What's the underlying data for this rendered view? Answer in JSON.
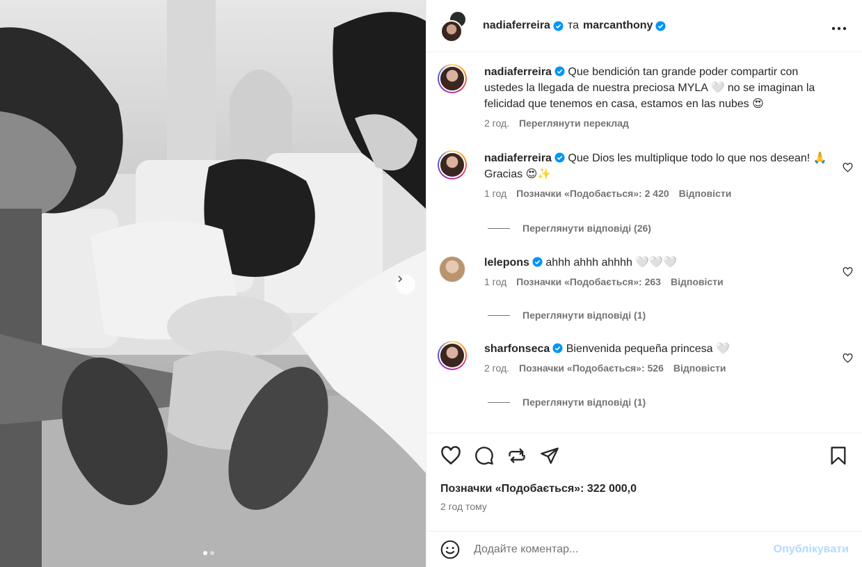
{
  "post": {
    "author": "nadiaferreira",
    "conjunction": "та",
    "coauthor": "marcanthony",
    "more_icon": "more-horizontal-icon"
  },
  "caption": {
    "user": "nadiaferreira",
    "text": "Que bendición tan grande poder compartir con ustedes la llegada de nuestra preciosa MYLA 🤍 no se imaginan la felicidad que tenemos en casa, estamos en las nubes 😍",
    "time": "2 год.",
    "translate": "Переглянути переклад"
  },
  "comments": [
    {
      "user": "nadiaferreira",
      "text": "Que Dios les multiplique todo lo que nos desean! 🙏 Gracias 😍✨",
      "time": "1 год",
      "likes": "Позначки «Подобається»: 2 420",
      "reply": "Відповісти",
      "view_replies": "Переглянути відповіді (26)"
    },
    {
      "user": "lelepons",
      "text": "ahhh ahhh ahhhh 🤍🤍🤍",
      "time": "1 год",
      "likes": "Позначки «Подобається»: 263",
      "reply": "Відповісти",
      "view_replies": "Переглянути відповіді (1)"
    },
    {
      "user": "sharfonseca",
      "text": "Bienvenida pequeña princesa 🤍",
      "time": "2 год.",
      "likes": "Позначки «Подобається»: 526",
      "reply": "Відповісти",
      "view_replies": "Переглянути відповіді (1)"
    }
  ],
  "footer": {
    "likes": "Позначки «Подобається»: 322 000,0",
    "time": "2 год тому",
    "comment_placeholder": "Додайте коментар...",
    "publish": "Опублікувати"
  },
  "colors": {
    "verified": "#0095f6",
    "publish_disabled": "#b3dbff",
    "secondary_text": "#737373"
  }
}
